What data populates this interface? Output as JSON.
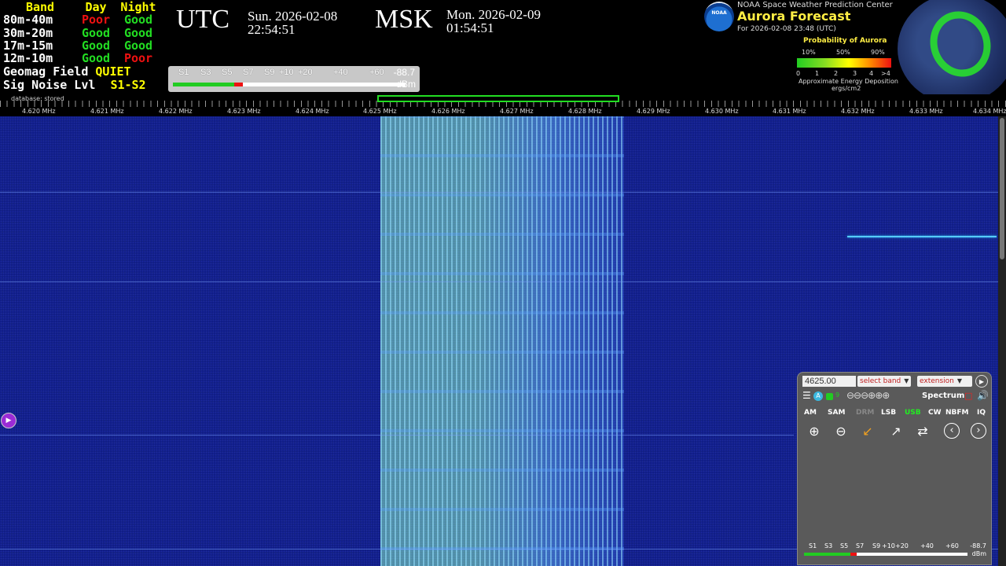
{
  "band_conditions": {
    "headers": {
      "band": "Band",
      "day": "Day",
      "night": "Night"
    },
    "rows": [
      {
        "band": "80m-40m",
        "day": "Poor",
        "night": "Good"
      },
      {
        "band": "30m-20m",
        "day": "Good",
        "night": "Good"
      },
      {
        "band": "17m-15m",
        "day": "Good",
        "night": "Good"
      },
      {
        "band": "12m-10m",
        "day": "Good",
        "night": "Poor"
      }
    ],
    "geomag_label": "Geomag Field",
    "geomag_value": "QUIET",
    "sig_noise_label": "Sig Noise Lvl",
    "sig_noise_value": "S1-S2",
    "colors": {
      "good": "#22dd22",
      "poor": "#ee1111",
      "header": "#ffff00"
    }
  },
  "clock_utc": {
    "label": "UTC",
    "date": "Sun. 2026-02-08",
    "time": "22:54:51"
  },
  "clock_msk": {
    "label": "MSK",
    "date": "Mon. 2026-02-09",
    "time": "01:54:51"
  },
  "smeter": {
    "labels": [
      "S1",
      "S3",
      "S5",
      "S7",
      "S9",
      "+10",
      "+20",
      "+40",
      "+60"
    ],
    "dbm_value": "-88.7",
    "unit": "dBm",
    "level_fraction": 0.3
  },
  "aurora": {
    "agency": "NOAA Space Weather Prediction Center",
    "title": "Aurora Forecast",
    "for_time": "For 2026-02-08 23:48 (UTC)",
    "probability_label": "Probability of Aurora",
    "pct_ticks": [
      "10%",
      "50%",
      "90%"
    ],
    "energy_ticks": [
      "0",
      "1",
      "2",
      "3",
      "4",
      ">4"
    ],
    "energy_label": "Approximate Energy Deposition",
    "energy_units": "ergs/cm2",
    "logo_text": "NOAA"
  },
  "scale": {
    "database_label": "database: stored",
    "freq_labels": [
      "4.620 MHz",
      "4.621 MHz",
      "4.622 MHz",
      "4.623 MHz",
      "4.624 MHz",
      "4.625 MHz",
      "4.626 MHz",
      "4.627 MHz",
      "4.628 MHz",
      "4.629 MHz",
      "4.630 MHz",
      "4.631 MHz",
      "4.632 MHz",
      "4.633 MHz",
      "4.634 MHz"
    ]
  },
  "panel": {
    "frequency": "4625.00",
    "band_select": "select band",
    "extension_select": "extension",
    "spectrum_label": "Spectrum",
    "modes": [
      {
        "label": "AM",
        "state": "normal"
      },
      {
        "label": "SAM",
        "state": "normal"
      },
      {
        "label": "DRM",
        "state": "disabled"
      },
      {
        "label": "LSB",
        "state": "normal"
      },
      {
        "label": "USB",
        "state": "active"
      },
      {
        "label": "CW",
        "state": "normal"
      },
      {
        "label": "NBFM",
        "state": "normal"
      },
      {
        "label": "IQ",
        "state": "normal"
      }
    ],
    "smeter": {
      "labels": [
        "S1",
        "S3",
        "S5",
        "S7",
        "S9",
        "+10",
        "+20",
        "+40",
        "+60"
      ],
      "dbm_value": "-88.7",
      "unit": "dBm",
      "level_fraction": 0.32
    },
    "icons": [
      "menu-icon",
      "auto-icon",
      "zoom-in-icon",
      "zoom-out-icon",
      "zoom-fit-icon",
      "zoom-max-icon",
      "swap-icon",
      "prev-icon",
      "next-icon",
      "speaker-icon",
      "play-icon"
    ]
  }
}
